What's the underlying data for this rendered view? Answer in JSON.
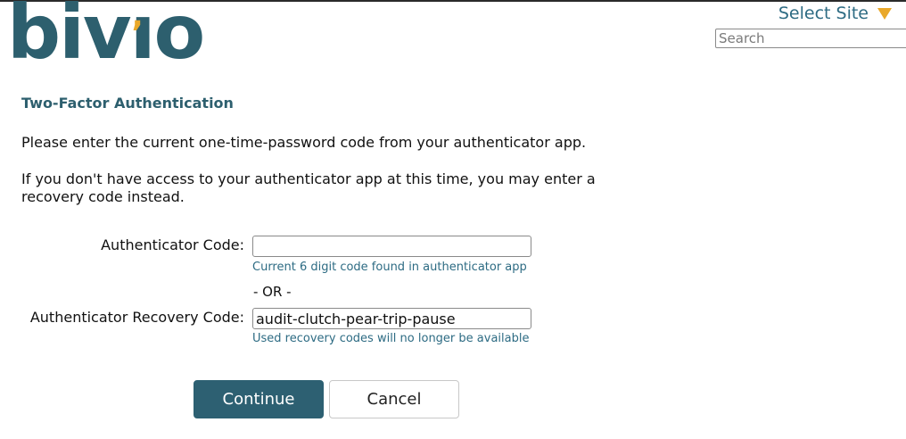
{
  "header": {
    "logo_text": "bivio",
    "logo_trademark": "™",
    "select_site_label": "Select Site",
    "search_placeholder": "Search"
  },
  "main": {
    "heading": "Two-Factor Authentication",
    "instructions": "Please enter the current one-time-password code from your authenticator app.",
    "recovery_note": "If you don't have access to your authenticator app at this time, you may enter a recovery code instead."
  },
  "form": {
    "authenticator_code_label": "Authenticator Code:",
    "authenticator_code_value": "",
    "authenticator_code_hint": "Current 6 digit code found in authenticator app",
    "or_separator": "- OR -",
    "recovery_code_label": "Authenticator Recovery Code:",
    "recovery_code_value": "audit-clutch-pear-trip-pause",
    "recovery_code_hint": "Used recovery codes will no longer be available"
  },
  "buttons": {
    "continue_label": "Continue",
    "cancel_label": "Cancel"
  },
  "colors": {
    "brand_teal": "#2d5f6e",
    "brand_gold": "#e9a82a",
    "link_blue": "#2d6b83"
  },
  "icons": {
    "select_site_dropdown": "triangle-down-icon"
  }
}
